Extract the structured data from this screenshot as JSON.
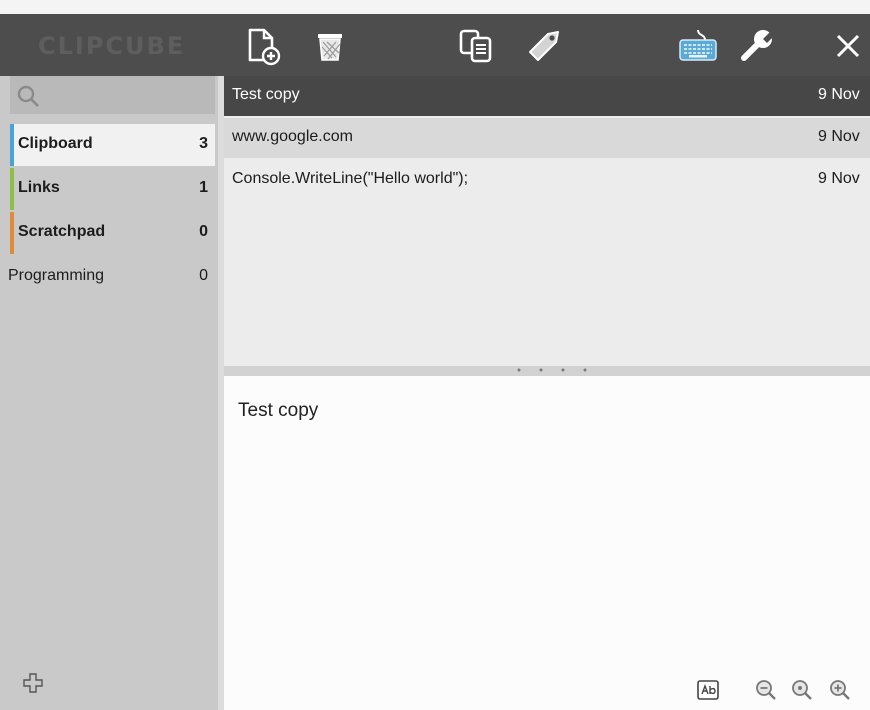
{
  "app": {
    "logo": "CLIPCUBE"
  },
  "toolbar": {
    "buttons": [
      {
        "name": "new-clip",
        "icon": "document-add-icon"
      },
      {
        "name": "delete",
        "icon": "trash-icon"
      },
      {
        "name": "copy",
        "icon": "copy-icon"
      },
      {
        "name": "tag",
        "icon": "tag-icon"
      },
      {
        "name": "keyboard",
        "icon": "keyboard-icon"
      },
      {
        "name": "settings",
        "icon": "wrench-icon"
      },
      {
        "name": "close",
        "icon": "close-icon"
      }
    ]
  },
  "sidebar": {
    "search_placeholder": "",
    "categories": [
      {
        "label": "Clipboard",
        "count": "3",
        "accent": "#4aa3d8",
        "selected": true
      },
      {
        "label": "Links",
        "count": "1",
        "accent": "#8fbf4a",
        "selected": false
      },
      {
        "label": "Scratchpad",
        "count": "0",
        "accent": "#e08a3c",
        "selected": false
      },
      {
        "label": "Programming",
        "count": "0",
        "accent": "",
        "selected": false
      }
    ]
  },
  "clips": {
    "items": [
      {
        "text": "Test copy",
        "date": "9 Nov"
      },
      {
        "text": "www.google.com",
        "date": "9 Nov"
      },
      {
        "text": "Console.WriteLine(\"Hello world\");",
        "date": "9 Nov"
      }
    ]
  },
  "preview": {
    "text": "Test copy"
  },
  "colors": {
    "toolbar_bg": "#4d4d4d",
    "sidebar_bg": "#c9c9c9",
    "selected_row": "#474747",
    "keyboard_accent": "#5aa9d6"
  }
}
